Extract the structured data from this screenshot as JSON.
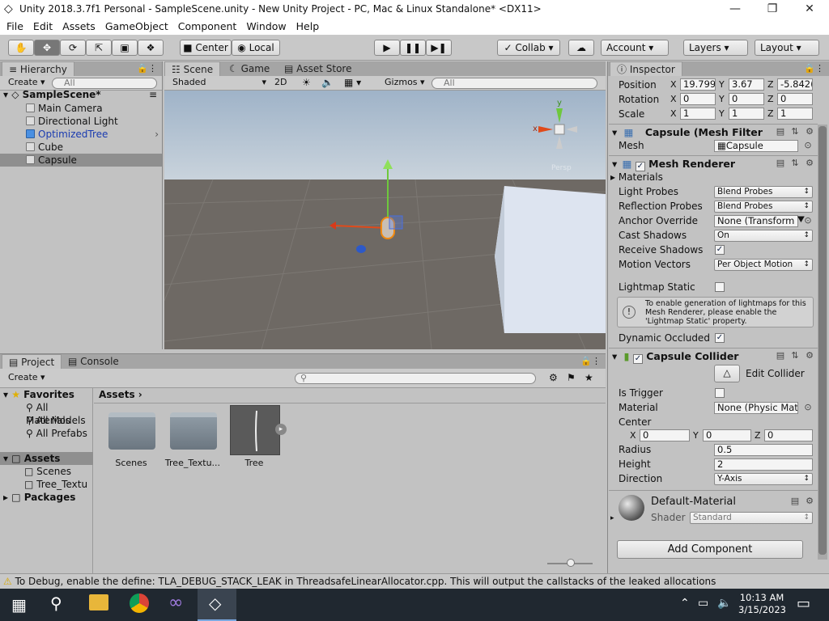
{
  "window": {
    "title": "Unity 2018.3.7f1 Personal - SampleScene.unity - New Unity Project - PC, Mac & Linux Standalone* <DX11>",
    "minimize": "—",
    "maximize": "❐",
    "close": "✕"
  },
  "menu": [
    "File",
    "Edit",
    "Assets",
    "GameObject",
    "Component",
    "Window",
    "Help"
  ],
  "toolbar": {
    "center": "Center",
    "local": "Local",
    "collab": "Collab",
    "account": "Account",
    "layers": "Layers",
    "layout": "Layout"
  },
  "hierarchy": {
    "tab": "Hierarchy",
    "create": "Create",
    "search_placeholder": "All",
    "scene": "SampleScene*",
    "items": [
      "Main Camera",
      "Directional Light",
      "OptimizedTree",
      "Cube",
      "Capsule"
    ]
  },
  "scene": {
    "tabs": [
      "Scene",
      "Game",
      "Asset Store"
    ],
    "shading": "Shaded",
    "mode2d": "2D",
    "gizmos": "Gizmos",
    "search_placeholder": "All",
    "gizmo_label": "Persp",
    "axis_y": "y",
    "axis_x": "x"
  },
  "project": {
    "tabs": [
      "Project",
      "Console"
    ],
    "create": "Create",
    "favorites": "Favorites",
    "favorite_items": [
      "All Materials",
      "All Models",
      "All Prefabs"
    ],
    "assets_root": "Assets",
    "asset_folders": [
      "Scenes",
      "Tree_Textu"
    ],
    "packages": "Packages",
    "breadcrumb": "Assets",
    "asset_tiles": [
      "Scenes",
      "Tree_Textu...",
      "Tree"
    ]
  },
  "inspector": {
    "tab": "Inspector",
    "transform": {
      "position": {
        "label": "Position",
        "x": "19.799",
        "y": "3.67",
        "z": "-5.842("
      },
      "rotation": {
        "label": "Rotation",
        "x": "0",
        "y": "0",
        "z": "0"
      },
      "scale": {
        "label": "Scale",
        "x": "1",
        "y": "1",
        "z": "1"
      }
    },
    "mesh_filter": {
      "title": "Capsule (Mesh Filter",
      "mesh_label": "Mesh",
      "mesh_value": "Capsule"
    },
    "mesh_renderer": {
      "title": "Mesh Renderer",
      "materials": "Materials",
      "light_probes": {
        "label": "Light Probes",
        "value": "Blend Probes"
      },
      "reflection_probes": {
        "label": "Reflection Probes",
        "value": "Blend Probes"
      },
      "anchor_override": {
        "label": "Anchor Override",
        "value": "None (Transform"
      },
      "cast_shadows": {
        "label": "Cast Shadows",
        "value": "On"
      },
      "receive_shadows": {
        "label": "Receive Shadows"
      },
      "motion_vectors": {
        "label": "Motion Vectors",
        "value": "Per Object Motion"
      },
      "lightmap_static": {
        "label": "Lightmap Static"
      },
      "info": "To enable generation of lightmaps for this Mesh Renderer, please enable the 'Lightmap Static' property.",
      "dynamic_occluded": {
        "label": "Dynamic Occluded"
      }
    },
    "capsule_collider": {
      "title": "Capsule Collider",
      "edit_collider": "Edit Collider",
      "is_trigger": "Is Trigger",
      "material": {
        "label": "Material",
        "value": "None (Physic Mat"
      },
      "center": {
        "label": "Center",
        "x": "0",
        "y": "0",
        "z": "0"
      },
      "radius": {
        "label": "Radius",
        "value": "0.5"
      },
      "height": {
        "label": "Height",
        "value": "2"
      },
      "direction": {
        "label": "Direction",
        "value": "Y-Axis"
      }
    },
    "material": {
      "name": "Default-Material",
      "shader_label": "Shader",
      "shader_value": "Standard"
    },
    "add_component": "Add Component"
  },
  "status": "To Debug, enable the define: TLA_DEBUG_STACK_LEAK in ThreadsafeLinearAllocator.cpp. This will output the callstacks of the leaked allocations",
  "taskbar": {
    "time": "10:13 AM",
    "date": "3/15/2023"
  },
  "axis_letters": {
    "x": "X",
    "y": "Y",
    "z": "Z"
  }
}
